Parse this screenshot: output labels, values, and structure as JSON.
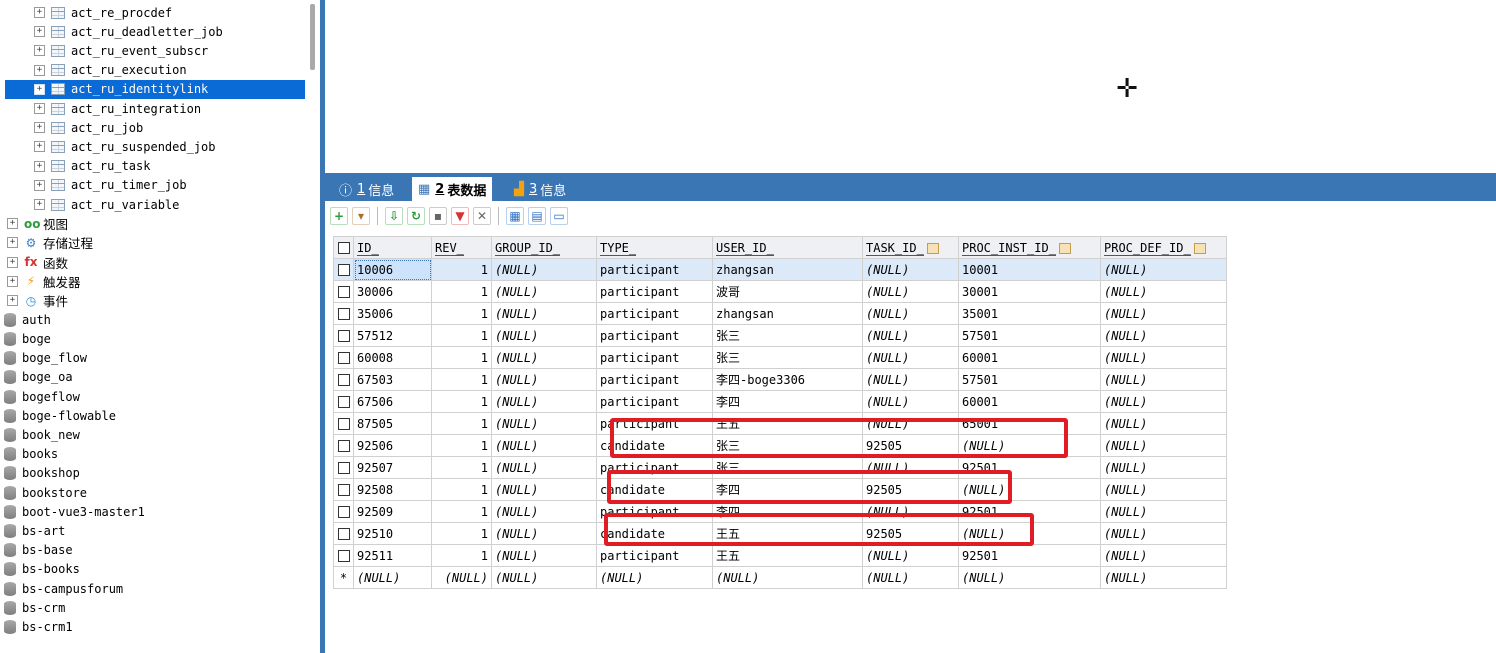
{
  "navigator": {
    "tables": [
      {
        "label": "act_re_procdef",
        "selected": false
      },
      {
        "label": "act_ru_deadletter_job",
        "selected": false
      },
      {
        "label": "act_ru_event_subscr",
        "selected": false
      },
      {
        "label": "act_ru_execution",
        "selected": false
      },
      {
        "label": "act_ru_identitylink",
        "selected": true
      },
      {
        "label": "act_ru_integration",
        "selected": false
      },
      {
        "label": "act_ru_job",
        "selected": false
      },
      {
        "label": "act_ru_suspended_job",
        "selected": false
      },
      {
        "label": "act_ru_task",
        "selected": false
      },
      {
        "label": "act_ru_timer_job",
        "selected": false
      },
      {
        "label": "act_ru_variable",
        "selected": false
      }
    ],
    "categories": [
      {
        "label": "视图",
        "icon": "views-icon",
        "glyph": "oo",
        "color": "#2a9d3a"
      },
      {
        "label": "存储过程",
        "icon": "gear-icon",
        "glyph": "⚙",
        "color": "#3d7cc9"
      },
      {
        "label": "函数",
        "icon": "function-icon",
        "glyph": "fx",
        "color": "#d93232"
      },
      {
        "label": "触发器",
        "icon": "lightning-icon",
        "glyph": "⚡",
        "color": "#f29d0f"
      },
      {
        "label": "事件",
        "icon": "clock-icon",
        "glyph": "◷",
        "color": "#2d8ad6"
      }
    ],
    "databases": [
      "auth",
      "boge",
      "boge_flow",
      "boge_oa",
      "bogeflow",
      "boge-flowable",
      "book_new",
      "books",
      "bookshop",
      "bookstore",
      "boot-vue3-master1",
      "bs-art",
      "bs-base",
      "bs-books",
      "bs-campusforum",
      "bs-crm",
      "bs-crm1"
    ]
  },
  "results": {
    "tabs": [
      {
        "num": "1",
        "label": "信息",
        "icon": "info-icon",
        "active": false
      },
      {
        "num": "2",
        "label": "表数据",
        "icon": "table-icon",
        "active": true
      },
      {
        "num": "3",
        "label": "信息",
        "icon": "chart-icon",
        "active": false
      }
    ],
    "toolbar": [
      {
        "name": "insert-row-button",
        "glyph": "+",
        "color": "#2a9d3a"
      },
      {
        "name": "export-dropdown-button",
        "glyph": "▾",
        "color": "#b06a2a"
      },
      {
        "name": "import-button",
        "glyph": "⇩",
        "color": "#2a9d3a"
      },
      {
        "name": "refresh-button",
        "glyph": "↻",
        "color": "#2a9d3a"
      },
      {
        "name": "save-button",
        "glyph": "▪",
        "color": "#666666"
      },
      {
        "name": "delete-button",
        "glyph": "▼",
        "color": "#d93232"
      },
      {
        "name": "cancel-button",
        "glyph": "✕",
        "color": "#666666"
      },
      {
        "name": "grid-view-button",
        "glyph": "▦",
        "color": "#2d6fc4"
      },
      {
        "name": "form-view-button",
        "glyph": "▤",
        "color": "#2d6fc4"
      },
      {
        "name": "text-view-button",
        "glyph": "▭",
        "color": "#2d6fc4"
      }
    ],
    "columns": [
      "ID_",
      "REV_",
      "GROUP_ID_",
      "TYPE_",
      "USER_ID_",
      "TASK_ID_",
      "PROC_INST_ID_",
      "PROC_DEF_ID_"
    ],
    "rows": [
      [
        "10006",
        "1",
        "(NULL)",
        "participant",
        "zhangsan",
        "(NULL)",
        "10001",
        "(NULL)"
      ],
      [
        "30006",
        "1",
        "(NULL)",
        "participant",
        "波哥",
        "(NULL)",
        "30001",
        "(NULL)"
      ],
      [
        "35006",
        "1",
        "(NULL)",
        "participant",
        "zhangsan",
        "(NULL)",
        "35001",
        "(NULL)"
      ],
      [
        "57512",
        "1",
        "(NULL)",
        "participant",
        "张三",
        "(NULL)",
        "57501",
        "(NULL)"
      ],
      [
        "60008",
        "1",
        "(NULL)",
        "participant",
        "张三",
        "(NULL)",
        "60001",
        "(NULL)"
      ],
      [
        "67503",
        "1",
        "(NULL)",
        "participant",
        "李四-boge3306",
        "(NULL)",
        "57501",
        "(NULL)"
      ],
      [
        "67506",
        "1",
        "(NULL)",
        "participant",
        "李四",
        "(NULL)",
        "60001",
        "(NULL)"
      ],
      [
        "87505",
        "1",
        "(NULL)",
        "participant",
        "王五",
        "(NULL)",
        "65001",
        "(NULL)"
      ],
      [
        "92506",
        "1",
        "(NULL)",
        "candidate",
        "张三",
        "92505",
        "(NULL)",
        "(NULL)"
      ],
      [
        "92507",
        "1",
        "(NULL)",
        "participant",
        "张三",
        "(NULL)",
        "92501",
        "(NULL)"
      ],
      [
        "92508",
        "1",
        "(NULL)",
        "candidate",
        "李四",
        "92505",
        "(NULL)",
        "(NULL)"
      ],
      [
        "92509",
        "1",
        "(NULL)",
        "participant",
        "李四",
        "(NULL)",
        "92501",
        "(NULL)"
      ],
      [
        "92510",
        "1",
        "(NULL)",
        "candidate",
        "王五",
        "92505",
        "(NULL)",
        "(NULL)"
      ],
      [
        "92511",
        "1",
        "(NULL)",
        "participant",
        "王五",
        "(NULL)",
        "92501",
        "(NULL)"
      ]
    ],
    "new_row": {
      "marker": "*",
      "values": [
        "(NULL)",
        "(NULL)",
        "(NULL)",
        "(NULL)",
        "(NULL)",
        "(NULL)",
        "(NULL)",
        "(NULL)"
      ]
    }
  }
}
